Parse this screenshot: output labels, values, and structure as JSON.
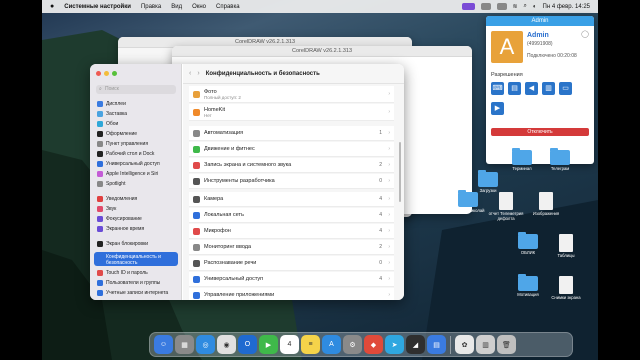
{
  "menubar": {
    "app": "Системные настройки",
    "items": [
      "Правка",
      "Вид",
      "Окно",
      "Справка"
    ],
    "datetime": "Пн 4 февр. 14:25"
  },
  "bg_windows": [
    {
      "title": "CorelDRAW v26.2.1.313"
    },
    {
      "title": "CorelDRAW v26.2.1.313"
    }
  ],
  "sysprefs": {
    "search_placeholder": "Поиск",
    "sidebar": [
      {
        "label": "Дисплеи",
        "color": "#3a7be0"
      },
      {
        "label": "Заставка",
        "color": "#4aa3e0"
      },
      {
        "label": "Обои",
        "color": "#2fa7d8"
      },
      {
        "label": "Оформление",
        "color": "#222222"
      },
      {
        "label": "Пункт управления",
        "color": "#888888"
      },
      {
        "label": "Рабочий стол и Dock",
        "color": "#222222"
      },
      {
        "label": "Универсальный доступ",
        "color": "#2f6fdb"
      },
      {
        "label": "Apple Intelligence и Siri",
        "color": "#c45cd6"
      },
      {
        "label": "Spotlight",
        "color": "#888888"
      },
      {
        "label": "Уведомления",
        "color": "#e04040"
      },
      {
        "label": "Звук",
        "color": "#e04a6a"
      },
      {
        "label": "Фокусирование",
        "color": "#6a4cd6"
      },
      {
        "label": "Экранное время",
        "color": "#6a4cd6"
      },
      {
        "label": "Экран блокировки",
        "color": "#222222"
      },
      {
        "label": "Конфиденциальность и безопасность",
        "color": "#2f6fdb",
        "selected": true
      },
      {
        "label": "Touch ID и пароль",
        "color": "#e04a4a"
      },
      {
        "label": "Пользователи и группы",
        "color": "#2f6fdb"
      },
      {
        "label": "Учетные записи интернета",
        "color": "#2f6fdb"
      }
    ],
    "header_title": "Конфиденциальность и безопасность",
    "rows": [
      {
        "label": "Фото",
        "sub": "Полный доступ: 2",
        "count": "",
        "color": "#e8a03a"
      },
      {
        "label": "HomeKit",
        "sub": "Нет",
        "count": "",
        "color": "#f08a2a"
      },
      {
        "label": "Автоматизация",
        "sub": "",
        "count": "1",
        "color": "#888888"
      },
      {
        "label": "Движение и фитнес",
        "sub": "",
        "count": "",
        "color": "#3fb94a"
      },
      {
        "label": "Запись экрана и системного звука",
        "sub": "",
        "count": "2",
        "color": "#e04a4a"
      },
      {
        "label": "Инструменты разработчика",
        "sub": "",
        "count": "0",
        "color": "#555555"
      },
      {
        "label": "Камера",
        "sub": "",
        "count": "4",
        "color": "#555555"
      },
      {
        "label": "Локальная сеть",
        "sub": "",
        "count": "4",
        "color": "#2f6fdb"
      },
      {
        "label": "Микрофон",
        "sub": "",
        "count": "4",
        "color": "#e04a4a"
      },
      {
        "label": "Мониторинг ввода",
        "sub": "",
        "count": "2",
        "color": "#888888"
      },
      {
        "label": "Распознавание речи",
        "sub": "",
        "count": "0",
        "color": "#555555"
      },
      {
        "label": "Универсальный доступ",
        "sub": "",
        "count": "4",
        "color": "#2f6fdb"
      },
      {
        "label": "Управление приложениями",
        "sub": "",
        "count": "",
        "color": "#2f6fdb"
      }
    ]
  },
  "admin_panel": {
    "title": "Admin",
    "avatar_letter": "A",
    "name": "Admin",
    "id": "(49991908)",
    "connected": "Подключено 00:20:08",
    "permissions_label": "Разрешения",
    "disconnect_label": "Отключить"
  },
  "desktop_icons": [
    {
      "label": "Загрузки",
      "kind": "folder"
    },
    {
      "label": "Терминал",
      "kind": "folder"
    },
    {
      "label": "Телеграм",
      "kind": "folder"
    },
    {
      "label": "Омелич Николай",
      "kind": "folder"
    },
    {
      "label": "отчет Телеметрия дефолта",
      "kind": "doc"
    },
    {
      "label": "Изображения",
      "kind": "doc"
    },
    {
      "label": "ОБЛИК",
      "kind": "folder"
    },
    {
      "label": "Таблицы",
      "kind": "doc"
    },
    {
      "label": "Мотивация",
      "kind": "folder"
    },
    {
      "label": "Снимки экрана",
      "kind": "doc"
    }
  ],
  "dock": [
    {
      "name": "finder",
      "color": "#3a7be0",
      "glyph": "☺"
    },
    {
      "name": "launchpad",
      "color": "#8a8a8a",
      "glyph": "▦"
    },
    {
      "name": "safari",
      "color": "#2f8be0",
      "glyph": "◎"
    },
    {
      "name": "chrome",
      "color": "#e0e0e0",
      "glyph": "◉"
    },
    {
      "name": "outlook",
      "color": "#1f6ad0",
      "glyph": "O"
    },
    {
      "name": "facetime",
      "color": "#3fb94a",
      "glyph": "▶"
    },
    {
      "name": "calendar",
      "color": "#ffffff",
      "glyph": "4"
    },
    {
      "name": "notes",
      "color": "#f5d34a",
      "glyph": "≡"
    },
    {
      "name": "appstore",
      "color": "#2f8be0",
      "glyph": "A"
    },
    {
      "name": "settings",
      "color": "#8a8a8a",
      "glyph": "⚙"
    },
    {
      "name": "anydesk",
      "color": "#e04a3a",
      "glyph": "◆"
    },
    {
      "name": "telegram",
      "color": "#2fa7e0",
      "glyph": "➤"
    },
    {
      "name": "pages",
      "color": "#2f2f2f",
      "glyph": "◢"
    },
    {
      "name": "docs",
      "color": "#3a7be0",
      "glyph": "▤"
    },
    {
      "name": "photos",
      "color": "#e8e8e8",
      "glyph": "✿"
    },
    {
      "name": "files",
      "color": "#cfcfcf",
      "glyph": "▥"
    },
    {
      "name": "trash",
      "color": "#bfbfbf",
      "glyph": "🗑"
    }
  ]
}
